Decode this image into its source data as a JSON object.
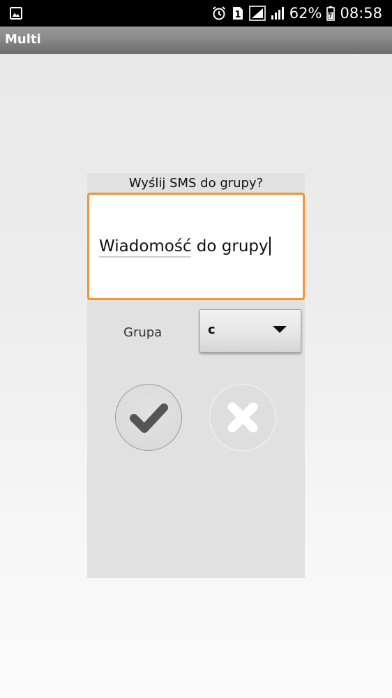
{
  "status_bar": {
    "battery_percent": "62%",
    "time": "08:58",
    "sim_slot": "1",
    "left_icon": "image-icon",
    "icons": [
      "alarm-icon",
      "sim-1-icon",
      "signal-icon",
      "signal-icon",
      "battery-icon"
    ]
  },
  "app": {
    "title": "Multi"
  },
  "dialog": {
    "title": "Wyślij SMS do grupy?",
    "message_value": "Wiadomość do grupy",
    "group_label": "Grupa",
    "group_selected": "c",
    "confirm_icon": "check-icon",
    "cancel_icon": "close-icon"
  },
  "colors": {
    "accent": "#f0952f",
    "status_bar": "#000000",
    "dialog_background": "#e1e1e1",
    "icon_check": "#555555",
    "icon_cancel": "#ffffff"
  }
}
